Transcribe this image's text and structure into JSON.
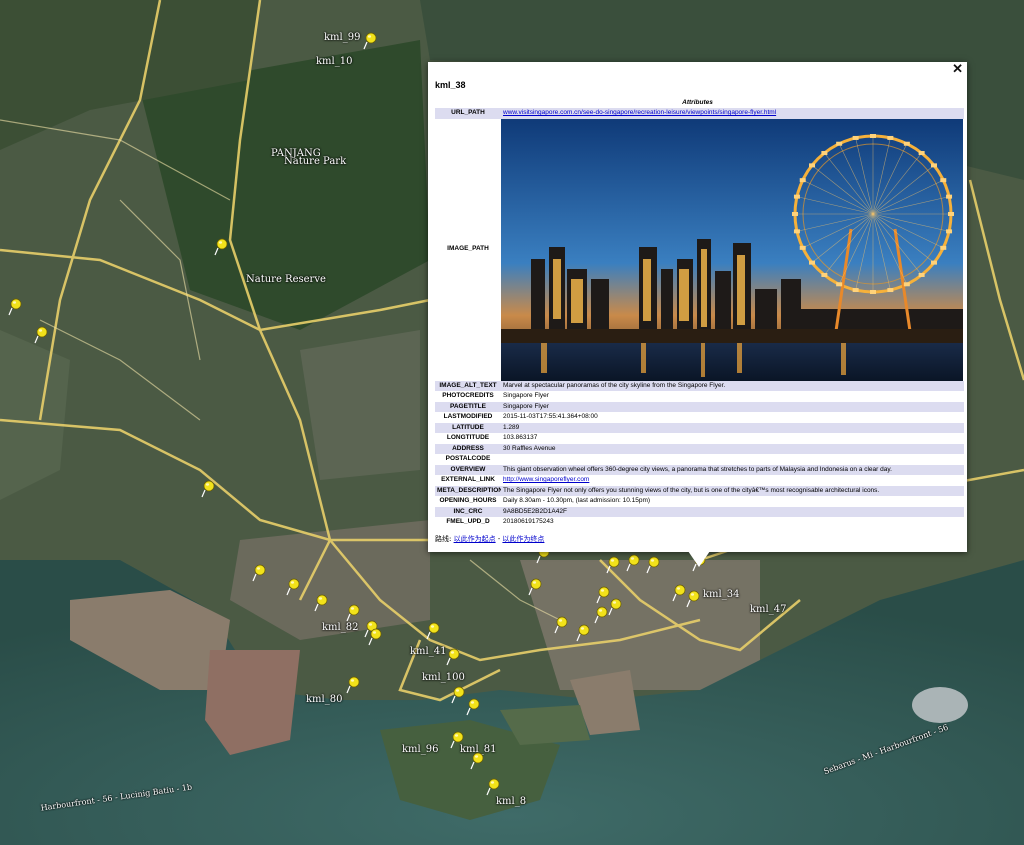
{
  "popup": {
    "close_glyph": "✕",
    "title": "kml_38",
    "caption": "Attributes",
    "photo_alt": "Marvel at spectacular panoramas of the city skyline from the Singapore Flyer.",
    "rows": [
      {
        "key": "URL_PATH",
        "value": "www.visitsingapore.com.cn/see-do-singapore/recreation-leisure/viewpoints/singapore-flyer.html",
        "link": true
      },
      {
        "key": "IMAGE_PATH",
        "value": "",
        "image": true
      },
      {
        "key": "IMAGE_ALT_TEXT",
        "value": "Marvel at spectacular panoramas of the city skyline from the Singapore Flyer."
      },
      {
        "key": "PHOTOCREDITS",
        "value": "Singapore Flyer"
      },
      {
        "key": "PAGETITLE",
        "value": "Singapore Flyer"
      },
      {
        "key": "LASTMODIFIED",
        "value": "2015-11-03T17:55:41.364+08:00"
      },
      {
        "key": "LATITUDE",
        "value": "1.289"
      },
      {
        "key": "LONGTITUDE",
        "value": "103.863137"
      },
      {
        "key": "ADDRESS",
        "value": "30 Raffles Avenue"
      },
      {
        "key": "POSTALCODE",
        "value": ""
      },
      {
        "key": "OVERVIEW",
        "value": "This giant observation wheel offers 360-degree city views, a panorama that stretches to parts of Malaysia and Indonesia on a clear day."
      },
      {
        "key": "EXTERNAL_LINK",
        "value": "http://www.singaporeflyer.com",
        "link": true
      },
      {
        "key": "META_DESCRIPTION",
        "value": "The Singapore Flyer not only offers you stunning views of the city, but is one of the cityâ€™s most recognisable architectural icons."
      },
      {
        "key": "OPENING_HOURS",
        "value": "Daily 8.30am - 10.30pm, (last admission: 10.15pm)"
      },
      {
        "key": "INC_CRC",
        "value": "9A8BD5E2B2D1A42F"
      },
      {
        "key": "FMEL_UPD_D",
        "value": "20180619175243"
      }
    ],
    "route": {
      "label": "路线:",
      "link_start": "以此作为起点",
      "separator": " - ",
      "link_end": "以此作为终点"
    }
  },
  "map": {
    "labels": [
      {
        "text": "kml_99"
      },
      {
        "text": "kml_10"
      },
      {
        "text": "PANJANG"
      },
      {
        "text": "Nature Park"
      },
      {
        "text": "Nature Reserve"
      },
      {
        "text": "kml_34"
      },
      {
        "text": "kml_82"
      },
      {
        "text": "kml_41"
      },
      {
        "text": "kml_100"
      },
      {
        "text": "kml_80"
      },
      {
        "text": "kml_96"
      },
      {
        "text": "kml_81"
      },
      {
        "text": "kml_8"
      },
      {
        "text": "kml_47"
      },
      {
        "text": "Harbourfront - 56 - Lucinig Batiu - 1b"
      },
      {
        "text": "Sebarus - Mi - Harbourfront - 56"
      }
    ],
    "pin_color": "#f2e21a"
  }
}
